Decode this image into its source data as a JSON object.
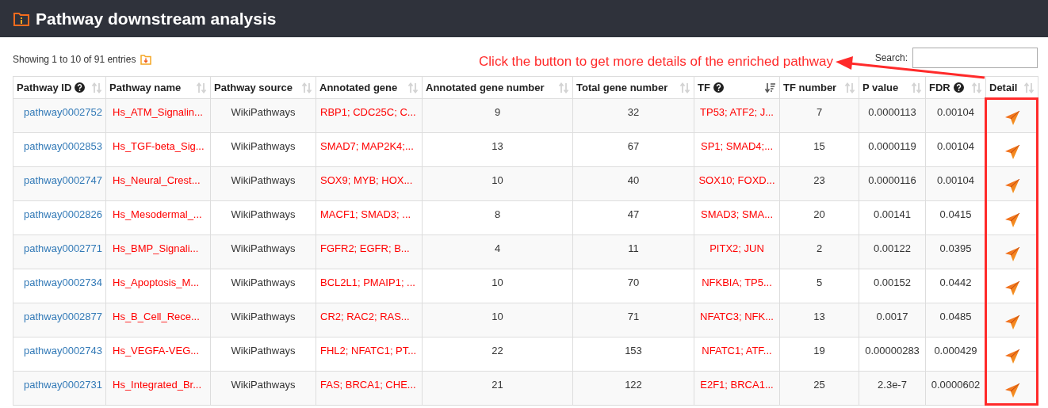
{
  "panel": {
    "title": "Pathway downstream analysis"
  },
  "info": "Showing 1 to 10 of 91 entries",
  "search": {
    "label": "Search:"
  },
  "annotation": {
    "text": "Click the button to get more details of the enriched pathway"
  },
  "table": {
    "columns": [
      {
        "label": "Pathway ID",
        "help": true,
        "sorted": false
      },
      {
        "label": "Pathway name",
        "help": false,
        "sorted": false
      },
      {
        "label": "Pathway source",
        "help": false,
        "sorted": false
      },
      {
        "label": "Annotated gene",
        "help": false,
        "sorted": false
      },
      {
        "label": "Annotated gene number",
        "help": false,
        "sorted": false
      },
      {
        "label": "Total gene number",
        "help": false,
        "sorted": false
      },
      {
        "label": "TF",
        "help": true,
        "sorted": true
      },
      {
        "label": "TF number",
        "help": false,
        "sorted": false
      },
      {
        "label": "P value",
        "help": false,
        "sorted": false
      },
      {
        "label": "FDR",
        "help": true,
        "sorted": false
      },
      {
        "label": "Detail",
        "help": false,
        "sorted": false
      }
    ],
    "rows": [
      {
        "id": "pathway0002752",
        "name": "Hs_ATM_Signalin...",
        "source": "WikiPathways",
        "genes": "RBP1; CDC25C; C...",
        "gene_number": "9",
        "total": "32",
        "tf": "TP53; ATF2; J...",
        "tf_number": "7",
        "p": "0.0000113",
        "fdr": "0.00104"
      },
      {
        "id": "pathway0002853",
        "name": "Hs_TGF-beta_Sig...",
        "source": "WikiPathways",
        "genes": "SMAD7; MAP2K4;...",
        "gene_number": "13",
        "total": "67",
        "tf": "SP1; SMAD4;...",
        "tf_number": "15",
        "p": "0.0000119",
        "fdr": "0.00104"
      },
      {
        "id": "pathway0002747",
        "name": "Hs_Neural_Crest...",
        "source": "WikiPathways",
        "genes": "SOX9; MYB; HOX...",
        "gene_number": "10",
        "total": "40",
        "tf": "SOX10; FOXD...",
        "tf_number": "23",
        "p": "0.0000116",
        "fdr": "0.00104"
      },
      {
        "id": "pathway0002826",
        "name": "Hs_Mesodermal_...",
        "source": "WikiPathways",
        "genes": "MACF1; SMAD3; ...",
        "gene_number": "8",
        "total": "47",
        "tf": "SMAD3; SMA...",
        "tf_number": "20",
        "p": "0.00141",
        "fdr": "0.0415"
      },
      {
        "id": "pathway0002771",
        "name": "Hs_BMP_Signali...",
        "source": "WikiPathways",
        "genes": "FGFR2; EGFR; B...",
        "gene_number": "4",
        "total": "11",
        "tf": "PITX2; JUN",
        "tf_number": "2",
        "p": "0.00122",
        "fdr": "0.0395"
      },
      {
        "id": "pathway0002734",
        "name": "Hs_Apoptosis_M...",
        "source": "WikiPathways",
        "genes": "BCL2L1; PMAIP1; ...",
        "gene_number": "10",
        "total": "70",
        "tf": "NFKBIA; TP5...",
        "tf_number": "5",
        "p": "0.00152",
        "fdr": "0.0442"
      },
      {
        "id": "pathway0002877",
        "name": "Hs_B_Cell_Rece...",
        "source": "WikiPathways",
        "genes": "CR2; RAC2; RAS...",
        "gene_number": "10",
        "total": "71",
        "tf": "NFATC3; NFK...",
        "tf_number": "13",
        "p": "0.0017",
        "fdr": "0.0485"
      },
      {
        "id": "pathway0002743",
        "name": "Hs_VEGFA-VEG...",
        "source": "WikiPathways",
        "genes": "FHL2; NFATC1; PT...",
        "gene_number": "22",
        "total": "153",
        "tf": "NFATC1; ATF...",
        "tf_number": "19",
        "p": "0.00000283",
        "fdr": "0.000429"
      },
      {
        "id": "pathway0002731",
        "name": "Hs_Integrated_Br...",
        "source": "WikiPathways",
        "genes": "FAS; BRCA1; CHE...",
        "gene_number": "21",
        "total": "122",
        "tf": "E2F1; BRCA1...",
        "tf_number": "25",
        "p": "2.3e-7",
        "fdr": "0.0000602"
      }
    ]
  }
}
